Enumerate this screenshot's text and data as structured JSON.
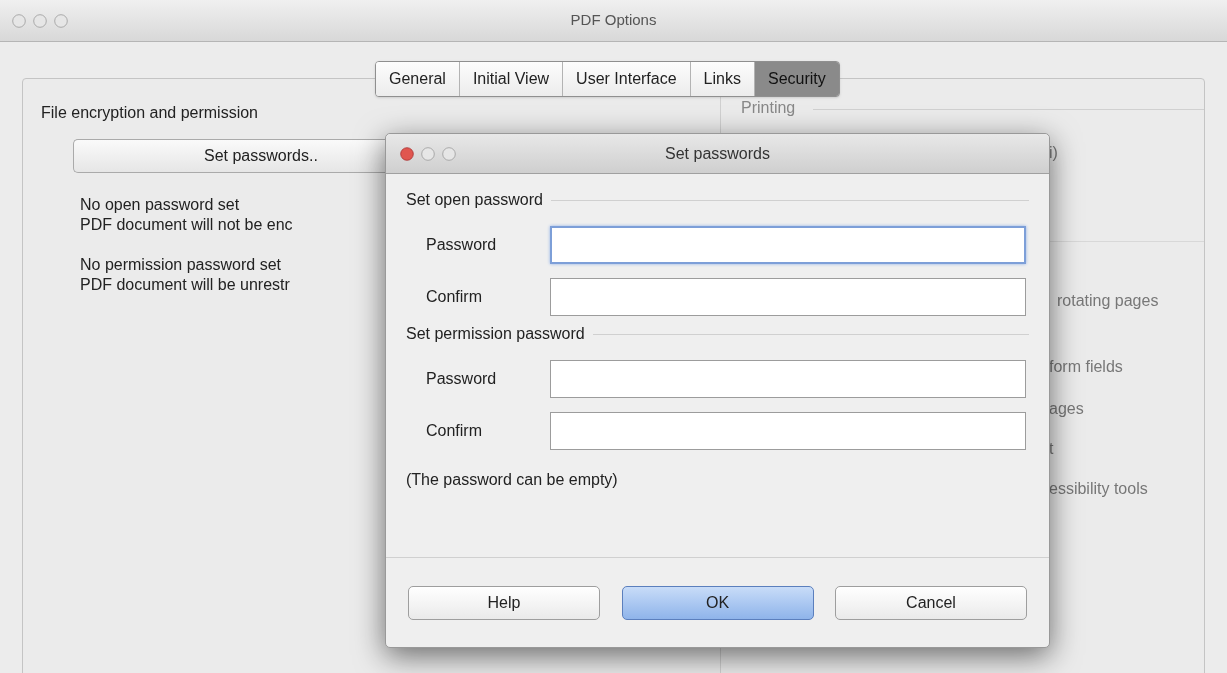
{
  "window": {
    "title": "PDF Options"
  },
  "tabs": [
    {
      "label": "General",
      "selected": false
    },
    {
      "label": "Initial View",
      "selected": false
    },
    {
      "label": "User Interface",
      "selected": false
    },
    {
      "label": "Links",
      "selected": false
    },
    {
      "label": "Security",
      "selected": true
    }
  ],
  "encryption": {
    "heading": "File encryption and permission",
    "button": "Set passwords..",
    "open_status": [
      "No open password set",
      "PDF document will not be enc"
    ],
    "permission_status": [
      "No permission password set",
      "PDF document will be unrestr"
    ]
  },
  "right_panel": {
    "heading": "Printing",
    "items": [
      "i)",
      "rotating pages",
      "form fields",
      "ages",
      "t",
      "essibility tools"
    ]
  },
  "dialog": {
    "title": "Set passwords",
    "sections": [
      {
        "heading": "Set open password",
        "fields": [
          {
            "label": "Password",
            "focused": true
          },
          {
            "label": "Confirm",
            "focused": false
          }
        ]
      },
      {
        "heading": "Set permission password",
        "fields": [
          {
            "label": "Password",
            "focused": false
          },
          {
            "label": "Confirm",
            "focused": false
          }
        ]
      }
    ],
    "note": "(The password can be empty)",
    "buttons": [
      {
        "label": "Help",
        "default": false
      },
      {
        "label": "OK",
        "default": true
      },
      {
        "label": "Cancel",
        "default": false
      }
    ]
  }
}
